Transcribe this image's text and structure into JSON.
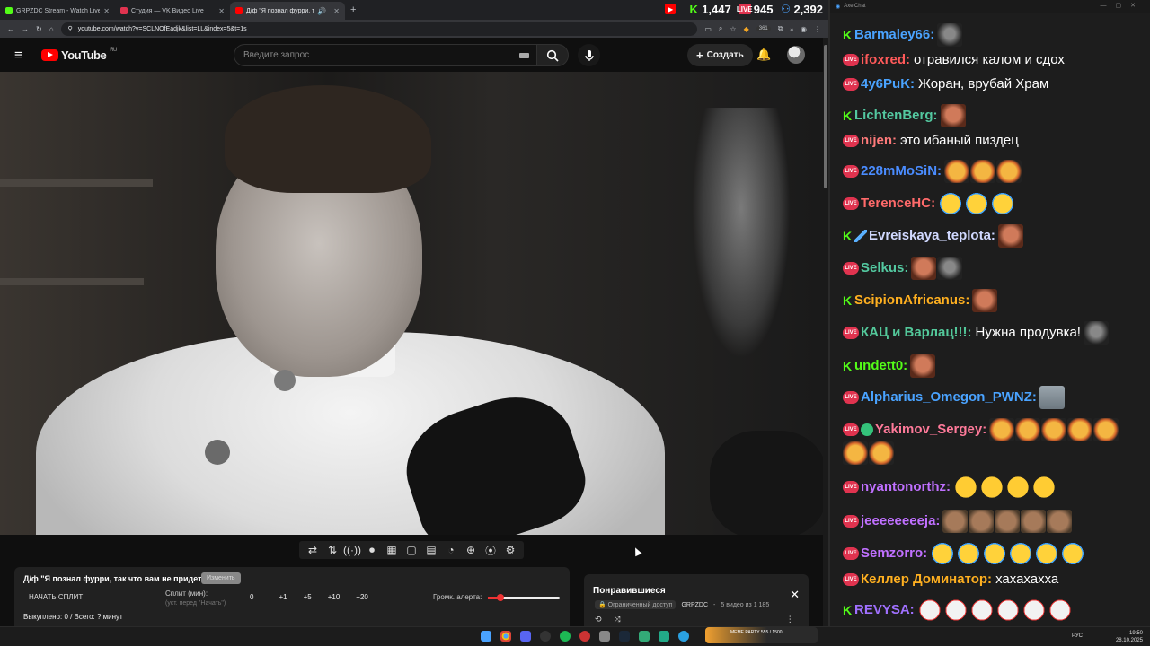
{
  "tabs": [
    {
      "title": "GRPZDC Stream - Watch Live o",
      "fav": "#53fc18",
      "active": false
    },
    {
      "title": "Студия — VK Видео Live",
      "fav": "#e0334f",
      "active": false
    },
    {
      "title": "Д/ф \"Я познал фурри, так",
      "fav": "#ff0000",
      "active": true
    }
  ],
  "counters": {
    "youtube": "1,447",
    "vk": "945",
    "kick": "2,392"
  },
  "address": {
    "url": "youtube.com/watch?v=SCLNOfEadjk&list=LL&index=5&t=1s",
    "ext_badge": "361"
  },
  "yt": {
    "logo_text": "YouTube",
    "region": "RU",
    "search_placeholder": "Введите запрос",
    "create_label": "Создать"
  },
  "controls": [
    "⇄",
    "⇅",
    "((·))",
    "⏺",
    "▦",
    "▢",
    "▤",
    "◔",
    "⊕",
    "⦿",
    "⚙"
  ],
  "panel": {
    "title": "Д/ф \"Я познал фурри, так что вам не придется\"",
    "badge": "Изменить",
    "start_split": "НАЧАТЬ СПЛИТ",
    "split_label": "Сплит (мин):",
    "split_hint": "(уст. перед \"Начать\")",
    "nums": [
      "0",
      "+1",
      "+5",
      "+10",
      "+20"
    ],
    "alert_label": "Громк. алерта:",
    "alert_volume": 0.18,
    "bought": "Выкуплено: 0 / Всего: ? минут"
  },
  "liked": {
    "title": "Понравившиеся",
    "access": "Ограниченный доступ",
    "channel": "GRPZDC",
    "count": "5 видео из 1 185"
  },
  "chat": {
    "window_title": "AxelChat",
    "messages": [
      {
        "platform": "kick",
        "nick": "Barmaley66:",
        "color": "#4aa3ff",
        "text": "",
        "emotes": [
          "dark"
        ]
      },
      {
        "platform": "vk",
        "nick": "ifoxred:",
        "color": "#ff5a5a",
        "text": "отравился калом и сдох",
        "emotes": []
      },
      {
        "platform": "vk",
        "nick": "4y6PuK:",
        "color": "#4aa3ff",
        "text": "Жоран, врубай Храм",
        "emotes": []
      },
      {
        "platform": "kick",
        "nick": "LichtenBerg:",
        "color": "#53c8a0",
        "text": "",
        "emotes": [
          "face"
        ]
      },
      {
        "platform": "vk",
        "nick": "nijen:",
        "color": "#ff7a7a",
        "text": "это ибаный пиздец",
        "emotes": []
      },
      {
        "platform": "vk",
        "nick": "228mMoSiN:",
        "color": "#4a8cff",
        "text": "",
        "emotes": [
          "cat",
          "cat",
          "cat"
        ]
      },
      {
        "platform": "vk",
        "nick": "TerenceHC:",
        "color": "#ff6a6a",
        "text": "",
        "emotes": [
          "cry",
          "cry",
          "cry"
        ]
      },
      {
        "platform": "kick",
        "nick": "Evreiskaya_teplota:",
        "color": "#d0d8ff",
        "text": "",
        "emotes": [
          "face"
        ]
      },
      {
        "platform": "vk",
        "nick": "Selkus:",
        "color": "#53c8a0",
        "text": "",
        "emotes": [
          "face",
          "dark"
        ]
      },
      {
        "platform": "kick",
        "nick": "ScipionAfricanus:",
        "color": "#ffb020",
        "text": "",
        "emotes": [
          "face"
        ]
      },
      {
        "platform": "vk",
        "nick": "КАЦ и Варлац!!!:",
        "color": "#53c89a",
        "text": "Нужна продувка!",
        "emotes": [
          "dark"
        ]
      },
      {
        "platform": "kick",
        "nick": "undett0:",
        "color": "#53fc18",
        "text": "",
        "emotes": [
          "face"
        ]
      },
      {
        "platform": "vk",
        "nick": "Alpharius_Omegon_PWNZ:",
        "color": "#4aa3ff",
        "text": "",
        "emotes": [
          "grey"
        ]
      },
      {
        "platform": "vk",
        "nick": "Yakimov_Sergey:",
        "color": "#ff7a9a",
        "text": "",
        "emotes": [
          "cat",
          "cat",
          "cat",
          "cat",
          "cat",
          "cat",
          "cat"
        ]
      },
      {
        "platform": "vk",
        "nick": "nyantonorthz:",
        "color": "#c070ff",
        "text": "",
        "emotes": [
          "laugh",
          "laugh",
          "laugh",
          "laugh"
        ]
      },
      {
        "platform": "vk",
        "nick": "jeeeeeeeeja:",
        "color": "#c070ff",
        "text": "",
        "emotes": [
          "skin",
          "skin",
          "skin",
          "skin",
          "skin"
        ]
      },
      {
        "platform": "vk",
        "nick": "Semzorro:",
        "color": "#c070ff",
        "text": "",
        "emotes": [
          "cry",
          "cry",
          "cry",
          "cry",
          "cry",
          "cry"
        ]
      },
      {
        "platform": "vk",
        "nick": "Келлер Доминатор:",
        "color": "#ffb020",
        "text": "хахахахха",
        "emotes": []
      },
      {
        "platform": "kick",
        "nick": "REVYSA:",
        "color": "#a070ff",
        "text": "",
        "emotes": [
          "pepe",
          "pepe",
          "pepe",
          "pepe",
          "pepe",
          "pepe"
        ]
      }
    ]
  },
  "taskbar": {
    "meme_text": "MEME PARTY",
    "meme_count": "555 / 1500",
    "lang": "РУС",
    "time": "19:50",
    "date": "28.10.2025"
  }
}
